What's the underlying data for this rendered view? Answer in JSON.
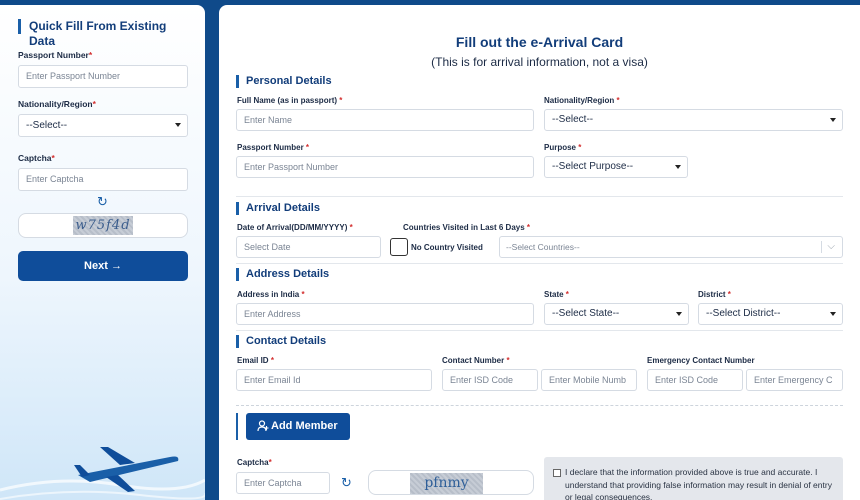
{
  "quick_fill": {
    "title": "Quick Fill From Existing Data",
    "passport_label": "Passport Number",
    "passport_placeholder": "Enter Passport Number",
    "nationality_label": "Nationality/Region",
    "nationality_value": "--Select--",
    "captcha_label": "Captcha",
    "captcha_placeholder": "Enter Captcha",
    "captcha_text": "w75f4d",
    "next_label": "Next →"
  },
  "form": {
    "title": "Fill out the e-Arrival Card",
    "subtitle": "(This is for arrival information, not a visa)",
    "personal": {
      "heading": "Personal Details",
      "full_name_label": "Full Name (as in passport)",
      "full_name_placeholder": "Enter Name",
      "nationality_label": "Nationality/Region",
      "nationality_value": "--Select--",
      "passport_label": "Passport Number",
      "passport_placeholder": "Enter Passport Number",
      "purpose_label": "Purpose",
      "purpose_value": "--Select Purpose--"
    },
    "arrival": {
      "heading": "Arrival Details",
      "date_label": "Date of Arrival(DD/MM/YYYY)",
      "date_placeholder": "Select Date",
      "countries_label": "Countries Visited in Last 6 Days",
      "no_country_label": "No Country Visited",
      "countries_placeholder": "--Select Countries--"
    },
    "address": {
      "heading": "Address Details",
      "address_label": "Address in India",
      "address_placeholder": "Enter Address",
      "state_label": "State",
      "state_value": "--Select State--",
      "district_label": "District",
      "district_value": "--Select District--"
    },
    "contact": {
      "heading": "Contact Details",
      "email_label": "Email ID",
      "email_placeholder": "Enter Email Id",
      "contact_label": "Contact Number",
      "isd_placeholder": "Enter ISD Code",
      "mobile_placeholder": "Enter Mobile Numb",
      "emergency_label": "Emergency Contact Number",
      "emergency_isd_placeholder": "Enter ISD Code",
      "emergency_placeholder": "Enter Emergency C"
    },
    "add_member_label": "Add Member",
    "captcha_label": "Captcha",
    "captcha_placeholder": "Enter Captcha",
    "captcha_text": "pfnmy",
    "declaration": "I declare that the information provided above is true and accurate. I understand that providing false information may result in denial of entry or legal consequences."
  },
  "colors": {
    "brand": "#0f4d9a",
    "heading": "#123d7a",
    "required": "#d32f2f",
    "frame": "#0f4a8a"
  },
  "icons": {
    "refresh": "refresh-icon",
    "arrow": "arrow-right-icon",
    "add_user": "add-user-icon",
    "plane": "airplane-illustration"
  }
}
